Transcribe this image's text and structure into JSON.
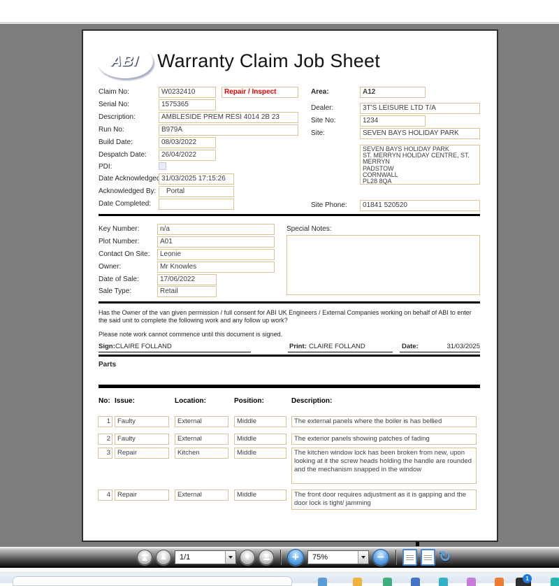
{
  "doc": {
    "logo_text": "ABI",
    "title": "Warranty Claim Job Sheet",
    "fields": {
      "claim_no": {
        "label": "Claim No:",
        "value": "W0232410"
      },
      "claim_type": {
        "value": "Repair / Inspect"
      },
      "serial_no": {
        "label": "Serial No:",
        "value": "1575365"
      },
      "description": {
        "label": "Description:",
        "value": "AMBLESIDE PREM RESI 4014 2B 23"
      },
      "run_no": {
        "label": "Run No:",
        "value": "B979A"
      },
      "build_date": {
        "label": "Build Date:",
        "value": "08/03/2022"
      },
      "despatch_date": {
        "label": "Despatch Date:",
        "value": "26/04/2022"
      },
      "pdi": {
        "label": "PDI:",
        "checked": false
      },
      "date_acknowledged": {
        "label": "Date Acknowledged:",
        "value": "31/03/2025 17:15:26"
      },
      "acknowledged_by": {
        "label": "Acknowledged By:",
        "value": "Portal"
      },
      "date_completed": {
        "label": "Date Completed:",
        "value": ""
      },
      "area": {
        "label": "Area:",
        "value": "A12"
      },
      "dealer": {
        "label": "Dealer:",
        "value": "3T'S LEISURE LTD T/A"
      },
      "site_no": {
        "label": "Site No:",
        "value": "1234"
      },
      "site": {
        "label": "Site:",
        "value": "SEVEN BAYS HOLIDAY PARK"
      },
      "site_address": {
        "lines": [
          "SEVEN BAYS HOLIDAY PARK",
          "ST. MERRYN HOLIDAY CENTRE, ST.",
          "MERRYN",
          "PADSTOW",
          "CORNWALL",
          "PL28 8QA"
        ]
      },
      "site_phone": {
        "label": "Site Phone:",
        "value": "01841 520520"
      },
      "key_number": {
        "label": "Key Number:",
        "value": "n/a"
      },
      "plot_number": {
        "label": "Plot Number:",
        "value": "A01"
      },
      "contact_on_site": {
        "label": "Contact On Site:",
        "value": "Leonie"
      },
      "owner": {
        "label": "Owner:",
        "value": "Mr Knowles"
      },
      "date_of_sale": {
        "label": "Date of Sale:",
        "value": "17/06/2022"
      },
      "sale_type": {
        "label": "Sale Type:",
        "value": "Retail"
      },
      "special_notes": {
        "label": "Special Notes:",
        "value": ""
      }
    },
    "consent": {
      "question": "Has the Owner of the van given permission / full consent for ABI UK Engineers / External Companies working on behalf of ABI to enter the said unit to complete the following work and any follow up work?",
      "note": "Please note work cannot commence until this document is signed.",
      "sign_label": "Sign:",
      "sign_value": "CLAIRE FOLLAND",
      "print_label": "Print:",
      "print_value": "CLAIRE FOLLAND",
      "date_label": "Date:",
      "date_value": "31/03/2025"
    },
    "parts": {
      "section_title": "Parts",
      "headers": {
        "no": "No:",
        "issue": "Issue:",
        "location": "Location:",
        "position": "Position:",
        "description": "Description:"
      },
      "rows": [
        {
          "no": "1",
          "issue": "Faulty",
          "location": "External",
          "position": "Middle",
          "description": "The external panels where the boiler is has bellied"
        },
        {
          "no": "2",
          "issue": "Faulty",
          "location": "External",
          "position": "Middle",
          "description": "The exterior panels showing patches of fading"
        },
        {
          "no": "3",
          "issue": "Repair",
          "location": "Kitchen",
          "position": "Middle",
          "description": "The kitchen window lock has been broken from new, upon looking at it the screw heads holding the handle are rounded and the mechanism snapped in the window"
        },
        {
          "no": "4",
          "issue": "Repair",
          "location": "External",
          "position": "Middle",
          "description": "The front door requires adjustment as it is gapping and the door lock is tight/ jamming"
        }
      ]
    }
  },
  "toolbar": {
    "page_indicator": "1/1",
    "zoom_level": "75%"
  },
  "taskbar": {
    "badge": {
      "text": "1",
      "color": "#1f7ae0"
    },
    "app_colors": [
      "#5b9bd5",
      "#f2b33c",
      "#3fae7a",
      "#4472c4",
      "#31b0c6",
      "#c77dd8",
      "#ed7d31",
      "#2d2d2d",
      "#26b3ad"
    ]
  },
  "colors": {
    "viewer_background": "#7d7d7d",
    "field_border": "#d9c49a",
    "accent_red": "#e60000",
    "logo_navy": "#1b2878"
  }
}
